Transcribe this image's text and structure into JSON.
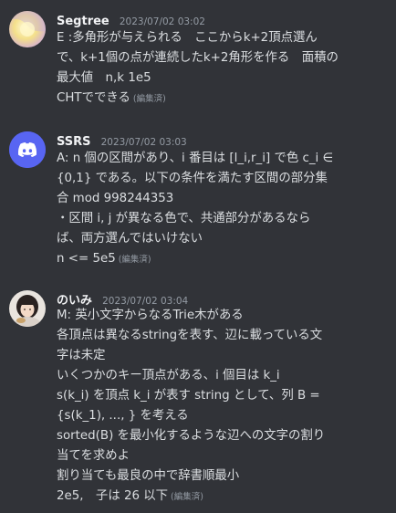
{
  "messages": [
    {
      "username": "Segtree",
      "timestamp": "2023/07/02 03:02",
      "lines": [
        "E :多角形が与えられる　ここからk+2頂点選ん",
        "で、k+1個の点が連続したk+2角形を作る　面積の",
        "最大値　n,k 1e5",
        "CHTでできる"
      ],
      "edited": "(編集済)"
    },
    {
      "username": "SSRS",
      "timestamp": "2023/07/02 03:03",
      "lines": [
        "A: n 個の区間があり、i 番目は [l_i,r_i] で色 c_i ∈",
        "{0,1} である。以下の条件を満たす区間の部分集",
        "合 mod 998244353",
        "・区間 i, j が異なる色で、共通部分があるなら",
        "ば、両方選んではいけない",
        "n <= 5e5"
      ],
      "edited": "(編集済)"
    },
    {
      "username": "のいみ",
      "timestamp": "2023/07/02 03:04",
      "lines": [
        "M: 英小文字からなるTrie木がある",
        "各頂点は異なるstringを表す、辺に載っている文",
        "字は未定",
        "いくつかのキー頂点がある、i 個目は k_i",
        "s(k_i) を頂点 k_i が表す string として、列 B =",
        "{s(k_1), ..., } を考える",
        "sorted(B) を最小化するような辺への文字の割り",
        "当てを求めよ",
        "割り当ても最良の中で辞書順最小",
        "2e5,　子は 26 以下"
      ],
      "edited": "(編集済)"
    }
  ],
  "colors": {
    "background": "#313338",
    "text": "#dbdee1",
    "username": "#f2f3f5",
    "muted": "#949ba4",
    "discord_blurple": "#5865f2"
  },
  "icons": [
    "segtree-avatar",
    "discord-logo-icon",
    "noimi-avatar"
  ]
}
